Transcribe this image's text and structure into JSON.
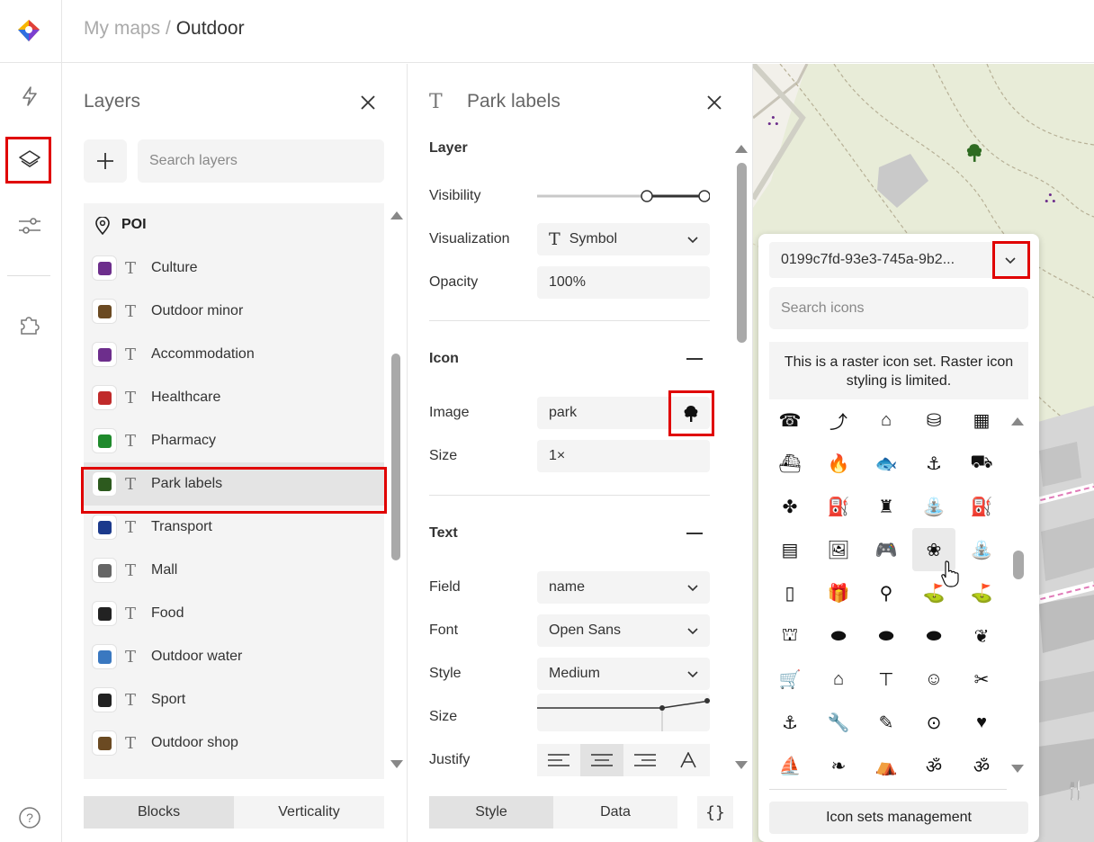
{
  "breadcrumb": {
    "parent": "My maps",
    "separator": " / ",
    "current": "Outdoor"
  },
  "rail": {
    "items": [
      "lightning-icon",
      "layers-icon",
      "sliders-icon",
      "puzzle-icon"
    ],
    "help_icon": "help-icon"
  },
  "layers_panel": {
    "title": "Layers",
    "search_placeholder": "Search layers",
    "group": "POI",
    "items": [
      {
        "name": "Culture",
        "color": "#6d2e8c"
      },
      {
        "name": "Outdoor minor",
        "color": "#6b4a22"
      },
      {
        "name": "Accommodation",
        "color": "#6d2e8c"
      },
      {
        "name": "Healthcare",
        "color": "#c02a2a"
      },
      {
        "name": "Pharmacy",
        "color": "#1f8a2c"
      },
      {
        "name": "Park labels",
        "color": "#2d5a1e",
        "selected": true
      },
      {
        "name": "Transport",
        "color": "#1c3a8c"
      },
      {
        "name": "Mall",
        "color": "#666666"
      },
      {
        "name": "Food",
        "color": "#222222"
      },
      {
        "name": "Outdoor water",
        "color": "#3a78c0"
      },
      {
        "name": "Sport",
        "color": "#222222"
      },
      {
        "name": "Outdoor shop",
        "color": "#6b4a22"
      }
    ],
    "tabs": {
      "blocks": "Blocks",
      "verticality": "Verticality"
    }
  },
  "props_panel": {
    "title": "Park labels",
    "layer_section": "Layer",
    "visibility_label": "Visibility",
    "visualization_label": "Visualization",
    "visualization_value": "Symbol",
    "opacity_label": "Opacity",
    "opacity_value": "100%",
    "icon_section": "Icon",
    "image_label": "Image",
    "image_value": "park",
    "size_label": "Size",
    "size_value": "1×",
    "text_section": "Text",
    "field_label": "Field",
    "field_value": "name",
    "font_label": "Font",
    "font_value": "Open Sans",
    "style_label": "Style",
    "style_value": "Medium",
    "text_size_label": "Size",
    "justify_label": "Justify",
    "tabs": {
      "style": "Style",
      "data": "Data",
      "code": "{}"
    }
  },
  "icon_picker": {
    "set_id": "0199c7fd-93e3-745a-9b2...",
    "search_placeholder": "Search icons",
    "notice": "This is a raster icon set. Raster icon styling is limited.",
    "management_button": "Icon sets management",
    "icons": [
      [
        "☎",
        "⤴",
        "⌂",
        "⛁",
        "▦"
      ],
      [
        "⛴",
        "🔥",
        "🐟",
        "⚓",
        "⛟"
      ],
      [
        "✤",
        "⛽",
        "♜",
        "⛲",
        "⛽"
      ],
      [
        "▤",
        "🖼",
        "🎮",
        "❀",
        "⛲"
      ],
      [
        "▯",
        "🎁",
        "⚲",
        "⛳",
        "⛳"
      ],
      [
        "⛫",
        "⬬",
        "⬬",
        "⬬",
        "❦"
      ],
      [
        "🛒",
        "⌂",
        "⊤",
        "☺",
        "✂"
      ],
      [
        "⚓",
        "🔧",
        "✎",
        "⊙",
        "♥"
      ],
      [
        "⛵",
        "❧",
        "⛺",
        "ॐ",
        "ॐ"
      ]
    ]
  },
  "colors": {
    "accent_highlight": "#e00000"
  }
}
